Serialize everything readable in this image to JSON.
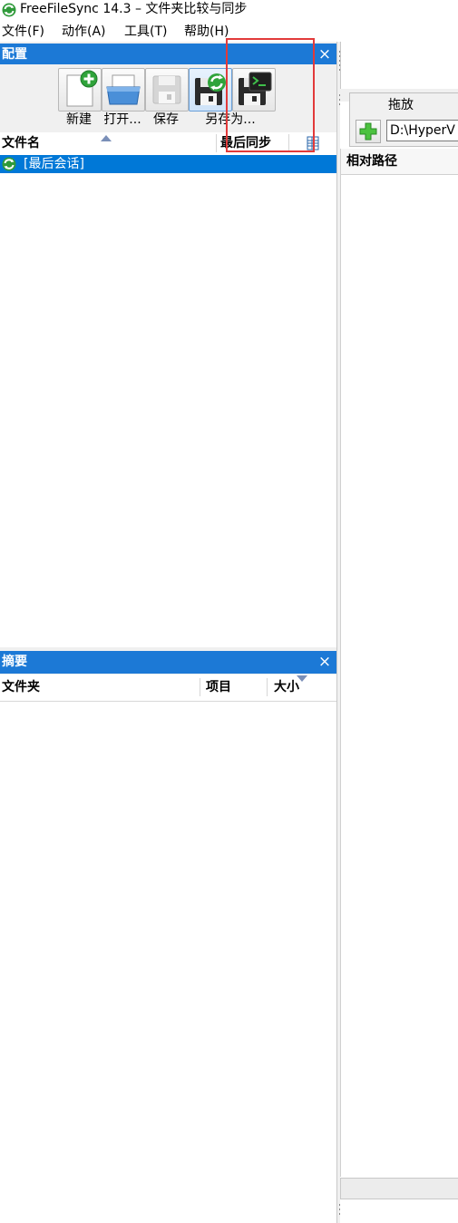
{
  "window": {
    "title": "FreeFileSync 14.3 – 文件夹比较与同步"
  },
  "menu": {
    "items": [
      {
        "label": "文件(F)"
      },
      {
        "label": "动作(A)"
      },
      {
        "label": "工具(T)"
      },
      {
        "label": "帮助(H)"
      }
    ]
  },
  "config_panel": {
    "title": "配置",
    "close_label": "×",
    "toolbar": {
      "new_label": "新建",
      "open_label": "打开...",
      "save_label": "保存",
      "save_as_label": "另存为...",
      "save_as_batch_label": ""
    },
    "columns": {
      "name": "文件名",
      "last_sync": "最后同步"
    },
    "items": [
      {
        "label": "[最后会话]",
        "selected": true
      }
    ]
  },
  "summary_panel": {
    "title": "摘要",
    "close_label": "×",
    "columns": {
      "folder": "文件夹",
      "items": "项目",
      "size": "大小"
    }
  },
  "folder_pair": {
    "drag_drop_label": "拖放",
    "path_value": "D:\\HyperV"
  },
  "file_grid": {
    "relative_path_header": "相对路径"
  },
  "colors": {
    "accent": "#1c79d6",
    "selection": "#0078d7",
    "highlight_box": "#e23a3a"
  }
}
